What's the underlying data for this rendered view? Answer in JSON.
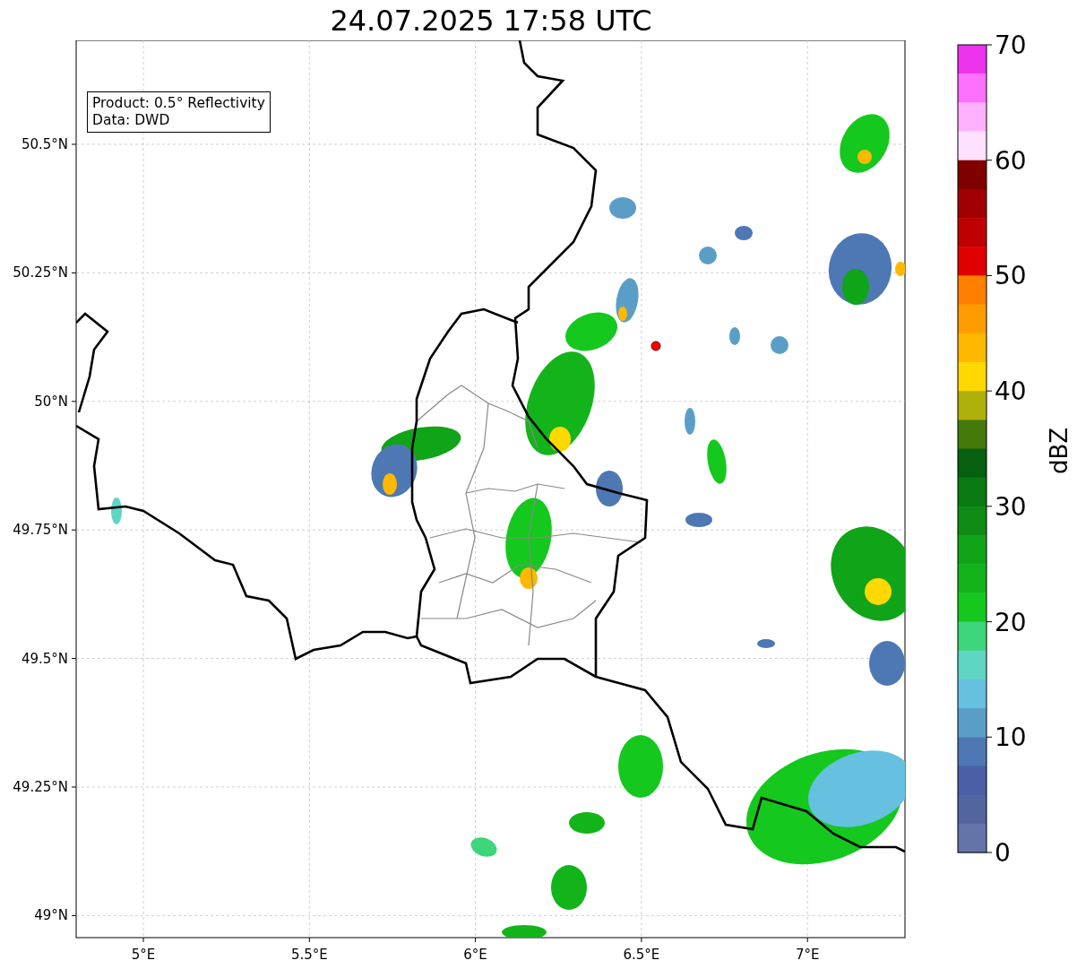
{
  "title": "24.07.2025 17:58 UTC",
  "info_box": {
    "lines": [
      "Product: 0.5° Reflectivity",
      "Data: DWD"
    ]
  },
  "map": {
    "lat_labels": [
      "50.5°N",
      "50.25°N",
      "50°N",
      "49.75°N",
      "49.5°N",
      "49.25°N",
      "49°N"
    ],
    "lon_labels": [
      "5°E",
      "5.5°E",
      "6°E",
      "6.5°E",
      "7°E"
    ]
  },
  "colorbar": {
    "label": "dBZ",
    "ticks": [
      "70",
      "60",
      "50",
      "40",
      "30",
      "20",
      "10",
      "0"
    ],
    "bins": [
      {
        "color": "#ee33ee"
      },
      {
        "color": "#ff70ff"
      },
      {
        "color": "#ffb0ff"
      },
      {
        "color": "#ffe0ff"
      },
      {
        "color": "#800000"
      },
      {
        "color": "#a00000"
      },
      {
        "color": "#c00000"
      },
      {
        "color": "#e00000"
      },
      {
        "color": "#ff8000"
      },
      {
        "color": "#ff9c00"
      },
      {
        "color": "#ffb800"
      },
      {
        "color": "#ffd800"
      },
      {
        "color": "#b0b00a"
      },
      {
        "color": "#447a0a"
      },
      {
        "color": "#066010"
      },
      {
        "color": "#0a7a12"
      },
      {
        "color": "#0e8c14"
      },
      {
        "color": "#10a418"
      },
      {
        "color": "#12b41a"
      },
      {
        "color": "#14c81e"
      },
      {
        "color": "#3dd67a"
      },
      {
        "color": "#5fd5c4"
      },
      {
        "color": "#66c0e0"
      },
      {
        "color": "#5a9ec8"
      },
      {
        "color": "#4d78b4"
      },
      {
        "color": "#4a5fa6"
      },
      {
        "color": "#52659e"
      },
      {
        "color": "#6374a8"
      }
    ]
  }
}
